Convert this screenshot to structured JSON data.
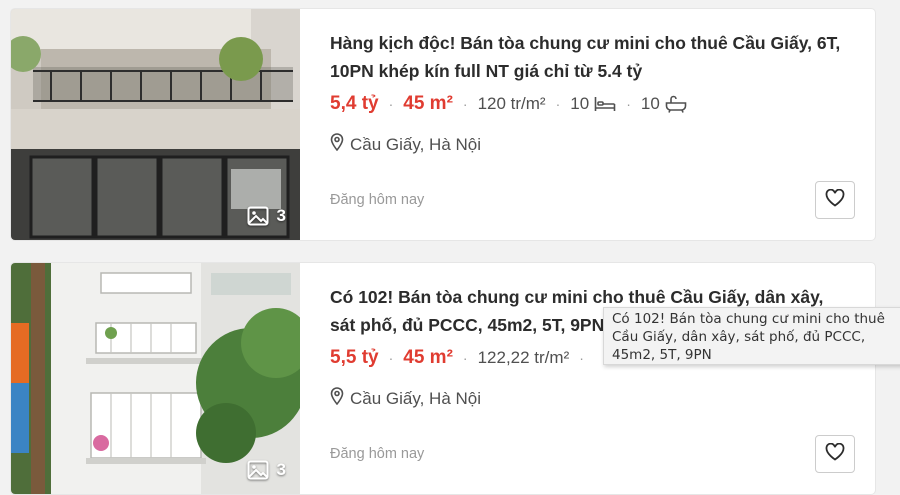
{
  "listings": [
    {
      "title": "Hàng kịch độc! Bán tòa chung cư mini cho thuê Cầu Giấy, 6T, 10PN khép kín full NT giá chỉ từ 5.4 tỷ",
      "price": "5,4 tỷ",
      "area": "45 m²",
      "price_per_m2": "120 tr/m²",
      "bedrooms": "10",
      "bathrooms": "10",
      "location": "Cầu Giấy, Hà Nội",
      "posted": "Đăng hôm nay",
      "photo_count": "3",
      "icons": [
        "image-icon",
        "bed-icon",
        "bath-icon",
        "location-pin-icon",
        "heart-icon"
      ]
    },
    {
      "title": "Có 102! Bán tòa chung cư mini cho thuê Cầu Giấy, dân xây, sát phố, đủ PCCC, 45m2, 5T, 9PN",
      "price": "5,5 tỷ",
      "area": "45 m²",
      "price_per_m2": "122,22 tr/m²",
      "location": "Cầu Giấy, Hà Nội",
      "posted": "Đăng hôm nay",
      "photo_count": "3"
    }
  ],
  "tooltip": {
    "text": "Có 102! Bán tòa chung cư mini cho thuê Cầu Giấy, dân xây, sát phố, đủ PCCC, 45m2, 5T, 9PN"
  },
  "colors": {
    "price": "#e03c31",
    "muted": "#999999",
    "text": "#2c2c2c",
    "background": "#f2f2f2"
  }
}
